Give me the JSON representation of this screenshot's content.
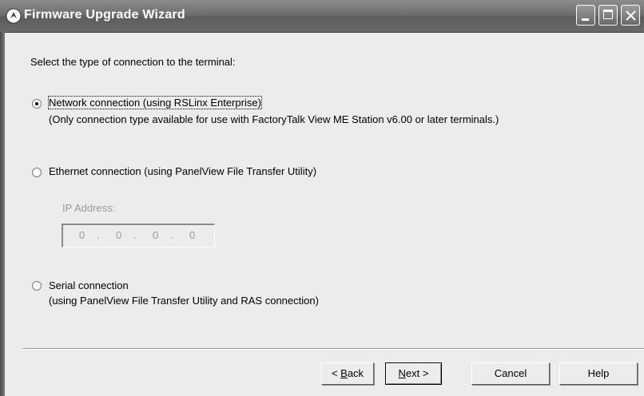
{
  "window": {
    "title": "Firmware Upgrade Wizard",
    "controls": {
      "minimize": "minimize",
      "maximize": "maximize",
      "close": "close"
    }
  },
  "prompt": "Select the type of connection to the terminal:",
  "options": [
    {
      "label": "Network connection (using RSLinx Enterprise)",
      "description": "(Only connection type available for use with FactoryTalk View ME Station v6.00 or later terminals.)",
      "selected": true
    },
    {
      "label": "Ethernet connection (using PanelView File Transfer Utility)",
      "selected": false
    },
    {
      "label": "Serial connection",
      "description": "(using PanelView File Transfer Utility and RAS connection)",
      "selected": false
    }
  ],
  "ip": {
    "label": "IP Address:",
    "octets": [
      "0",
      "0",
      "0",
      "0"
    ],
    "separator": "."
  },
  "buttons": {
    "back_prefix": "< ",
    "back_mnemonic": "B",
    "back_rest": "ack",
    "next_mnemonic": "N",
    "next_rest": "ext >",
    "cancel": "Cancel",
    "help": "Help"
  },
  "colors": {
    "titlebar": "#6e6e6e",
    "dialog_bg": "#ececec",
    "disabled_text": "#9a9a9a"
  }
}
